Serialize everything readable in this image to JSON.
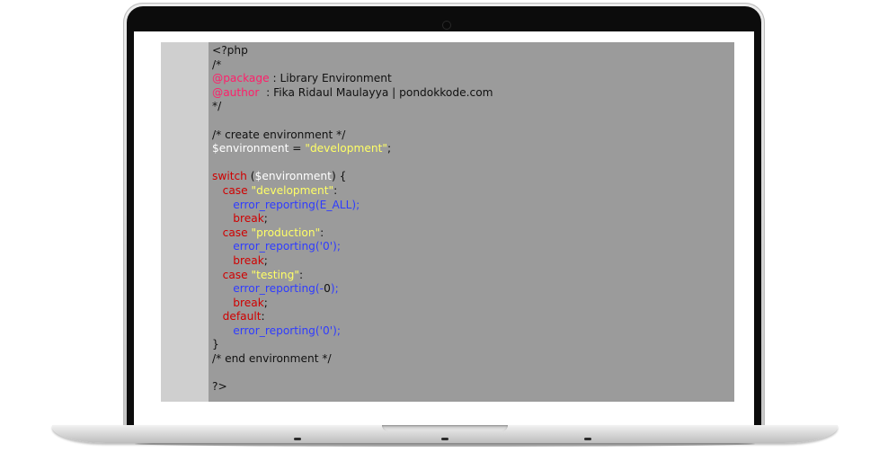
{
  "code": {
    "lines": [
      [
        {
          "t": "<?php",
          "c": "plain"
        }
      ],
      [
        {
          "t": "/*",
          "c": "plain"
        }
      ],
      [
        {
          "t": "@package",
          "c": "annot"
        },
        {
          "t": " : Library Environment",
          "c": "plain"
        }
      ],
      [
        {
          "t": "@author",
          "c": "annot"
        },
        {
          "t": "  : Fika Ridaul Maulayya | pondokkode.com",
          "c": "plain"
        }
      ],
      [
        {
          "t": "*/",
          "c": "plain"
        }
      ],
      [
        {
          "t": "",
          "c": "plain"
        }
      ],
      [
        {
          "t": "/* create environment */",
          "c": "plain"
        }
      ],
      [
        {
          "t": "$environment",
          "c": "var"
        },
        {
          "t": " = ",
          "c": "plain"
        },
        {
          "t": "\"development\"",
          "c": "str"
        },
        {
          "t": ";",
          "c": "plain"
        }
      ],
      [
        {
          "t": "",
          "c": "plain"
        }
      ],
      [
        {
          "t": "switch",
          "c": "kw"
        },
        {
          "t": " (",
          "c": "plain"
        },
        {
          "t": "$environment",
          "c": "var"
        },
        {
          "t": ") {",
          "c": "plain"
        }
      ],
      [
        {
          "t": "   case ",
          "c": "kw"
        },
        {
          "t": "\"development\"",
          "c": "str"
        },
        {
          "t": ":",
          "c": "plain"
        }
      ],
      [
        {
          "t": "      error_reporting(E_ALL);",
          "c": "fn"
        }
      ],
      [
        {
          "t": "      break",
          "c": "kw"
        },
        {
          "t": ";",
          "c": "plain"
        }
      ],
      [
        {
          "t": "   case ",
          "c": "kw"
        },
        {
          "t": "\"production\"",
          "c": "str"
        },
        {
          "t": ":",
          "c": "plain"
        }
      ],
      [
        {
          "t": "      error_reporting('0');",
          "c": "fn"
        }
      ],
      [
        {
          "t": "      break",
          "c": "kw"
        },
        {
          "t": ";",
          "c": "plain"
        }
      ],
      [
        {
          "t": "   case ",
          "c": "kw"
        },
        {
          "t": "\"testing\"",
          "c": "str"
        },
        {
          "t": ":",
          "c": "plain"
        }
      ],
      [
        {
          "t": "      error_reporting(-",
          "c": "fn"
        },
        {
          "t": "0",
          "c": "plain"
        },
        {
          "t": ");",
          "c": "fn"
        }
      ],
      [
        {
          "t": "      break",
          "c": "kw"
        },
        {
          "t": ";",
          "c": "plain"
        }
      ],
      [
        {
          "t": "   default",
          "c": "kw"
        },
        {
          "t": ":",
          "c": "plain"
        }
      ],
      [
        {
          "t": "      error_reporting('0');",
          "c": "fn"
        }
      ],
      [
        {
          "t": "}",
          "c": "plain"
        }
      ],
      [
        {
          "t": "/* end environment */",
          "c": "plain"
        }
      ],
      [
        {
          "t": "",
          "c": "plain"
        }
      ],
      [
        {
          "t": "?>",
          "c": "plain"
        }
      ]
    ]
  },
  "colors": {
    "screen_bg": "#9b9b9b",
    "gutter_bg": "#cfcfcf",
    "annotation": "#ff1f6a",
    "keyword": "#d00000",
    "string": "#ffff66",
    "function": "#2f3cff",
    "variable": "#ffffff",
    "text": "#111111"
  },
  "icons": {
    "camera": "webcam-icon"
  }
}
